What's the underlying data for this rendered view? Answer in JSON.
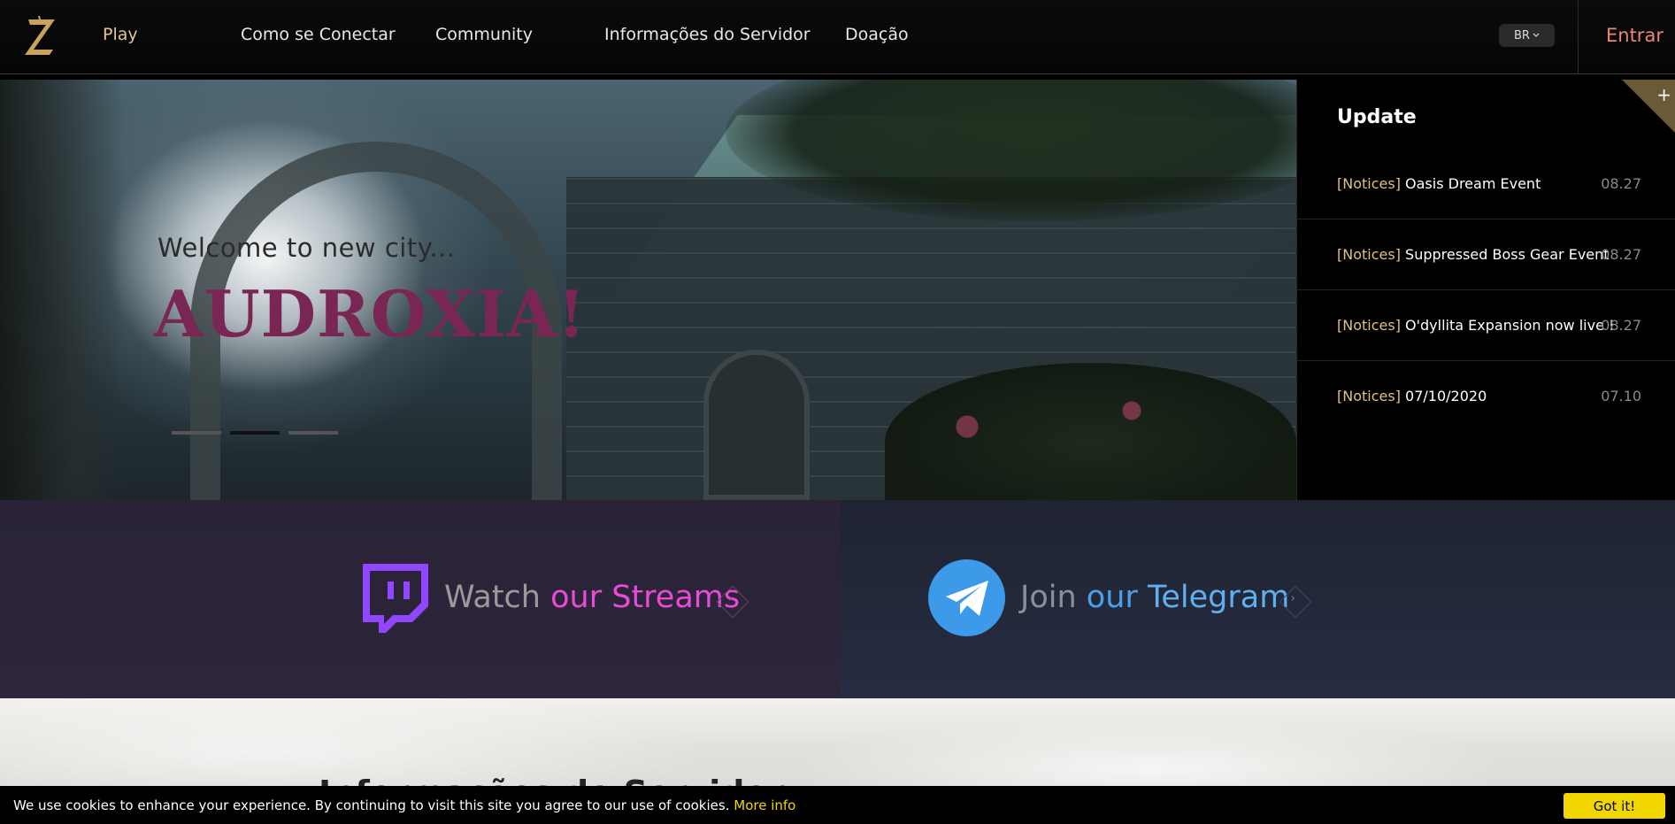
{
  "header": {
    "nav": [
      {
        "label": "Play",
        "active": true
      },
      {
        "label": "Como se Conectar"
      },
      {
        "label": "Community"
      },
      {
        "label": "Informações do Servidor"
      },
      {
        "label": "Doação"
      }
    ],
    "language": "BR",
    "login_label": "Entrar"
  },
  "hero": {
    "subtitle": "Welcome to new city...",
    "title": "AUDROXIA!",
    "slides_total": 3,
    "active_slide": 2
  },
  "updates": {
    "title": "Update",
    "plus_icon": "+",
    "items": [
      {
        "tag": "[Notices]",
        "text": "Oasis Dream Event",
        "date": "08.27"
      },
      {
        "tag": "[Notices]",
        "text": "Suppressed Boss Gear Event",
        "date": "08.27"
      },
      {
        "tag": "[Notices]",
        "text": "O'dyllita Expansion now live !",
        "date": "08.27"
      },
      {
        "tag": "[Notices]",
        "text": "07/10/2020",
        "date": "07.10"
      }
    ]
  },
  "social": {
    "twitch": {
      "prefix": "Watch",
      "highlight": "our Streams",
      "icon": "twitch-icon",
      "accent": "#e84bd6"
    },
    "telegram": {
      "prefix": "Join",
      "highlight_a": "our",
      "highlight_b": "Telegram",
      "icon": "telegram-icon",
      "accent": "#4aa0ea"
    },
    "arrow": "›"
  },
  "lower": {
    "title": "Informações do Servidor"
  },
  "cookie": {
    "text": "We use cookies to enhance your experience. By continuing to visit this site you agree to our use of cookies.",
    "link": "More info",
    "button": "Got it!"
  },
  "colors": {
    "gold": "#e4c58d",
    "login": "#e78974",
    "hero_title": "#7a2655",
    "cookie_button": "#f1d600"
  }
}
